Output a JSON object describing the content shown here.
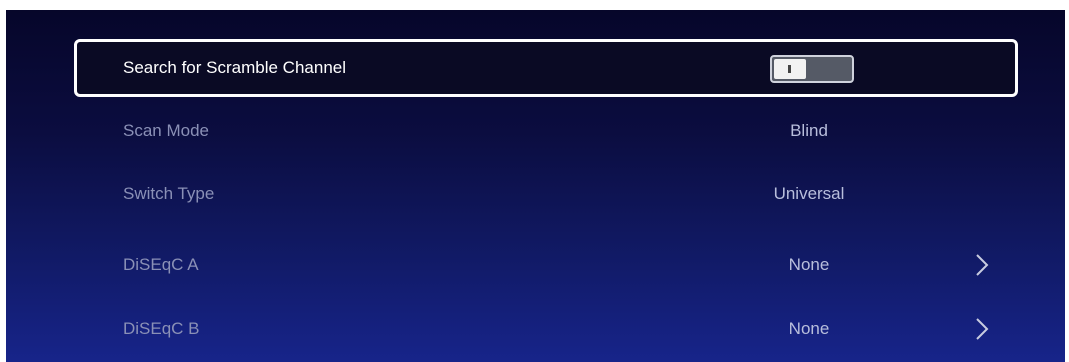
{
  "settings": {
    "items": [
      {
        "label": "Search for Scramble Channel",
        "type": "toggle",
        "state": "off"
      },
      {
        "label": "Scan Mode",
        "value": "Blind"
      },
      {
        "label": "Switch Type",
        "value": "Universal"
      },
      {
        "label": "DiSEqC A",
        "value": "None",
        "icon": "chevron-right-icon"
      },
      {
        "label": "DiSEqC B",
        "value": "None",
        "icon": "chevron-right-icon"
      }
    ]
  },
  "colors": {
    "background_top": "#06062a",
    "background_bottom": "#17248a",
    "focus_border": "#ffffff"
  }
}
